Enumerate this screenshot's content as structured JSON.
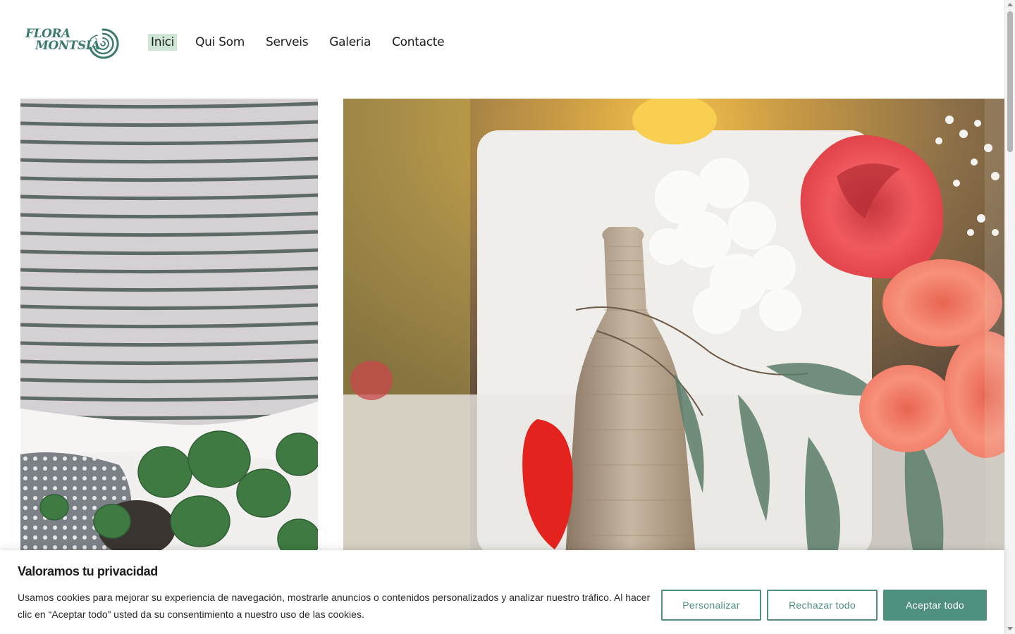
{
  "brand": {
    "logo_line1": "FLORA",
    "logo_line2": "MONTSIÀ",
    "logo_color": "#3c7a6b"
  },
  "nav": {
    "items": [
      {
        "label": "Inici",
        "active": true
      },
      {
        "label": "Qui Som",
        "active": false
      },
      {
        "label": "Serveis",
        "active": false
      },
      {
        "label": "Galeria",
        "active": false
      },
      {
        "label": "Contacte",
        "active": false
      }
    ],
    "active_highlight": "#cfe5d5"
  },
  "images": {
    "left": "person-holding-plant-photo",
    "right": "flower-arrangement-photo"
  },
  "cookie_banner": {
    "title": "Valoramos tu privacidad",
    "text": "Usamos cookies para mejorar su experiencia de navegación, mostrarle anuncios o contenidos personalizados y analizar nuestro tráfico. Al hacer clic en “Aceptar todo” usted da su consentimiento a nuestro uso de las cookies.",
    "buttons": {
      "customize": "Personalizar",
      "reject": "Rechazar todo",
      "accept": "Aceptar todo"
    },
    "accent_color": "#4f8f80"
  }
}
